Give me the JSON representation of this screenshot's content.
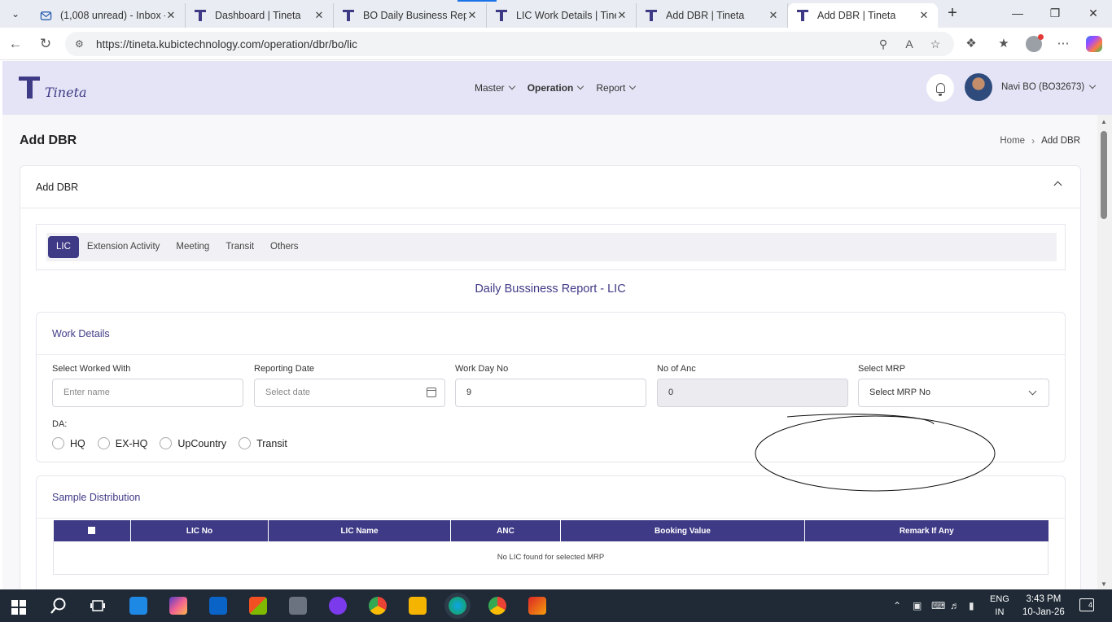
{
  "browser": {
    "tabs": [
      {
        "title": "(1,008 unread) - Inbox -",
        "icon": "mail-icon"
      },
      {
        "title": "Dashboard | Tineta",
        "icon": "tineta-favicon"
      },
      {
        "title": "BO Daily Business Repo",
        "icon": "tineta-favicon"
      },
      {
        "title": "LIC Work Details | Tinet",
        "icon": "tineta-favicon"
      },
      {
        "title": "Add DBR | Tineta",
        "icon": "tineta-favicon"
      },
      {
        "title": "Add DBR | Tineta",
        "icon": "tineta-favicon"
      }
    ],
    "url": "https://tineta.kubictechnology.com/operation/dbr/bo/lic"
  },
  "header": {
    "logo_text": "Tineta",
    "nav": [
      {
        "label": "Master"
      },
      {
        "label": "Operation"
      },
      {
        "label": "Report"
      }
    ],
    "user_name": "Navi BO (BO32673)"
  },
  "page": {
    "title": "Add DBR",
    "breadcrumb": {
      "home": "Home",
      "current": "Add DBR"
    }
  },
  "card": {
    "title": "Add DBR",
    "tabs": [
      "LIC",
      "Extension Activity",
      "Meeting",
      "Transit",
      "Others"
    ],
    "report_title": "Daily Bussiness Report - LIC"
  },
  "work_details": {
    "title": "Work Details",
    "fields": {
      "worked_with": {
        "label": "Select Worked With",
        "placeholder": "Enter name"
      },
      "reporting_date": {
        "label": "Reporting Date",
        "placeholder": "Select date"
      },
      "work_day_no": {
        "label": "Work Day No",
        "value": "9"
      },
      "no_of_anc": {
        "label": "No of Anc",
        "value": "0"
      },
      "mrp": {
        "label": "Select MRP",
        "value": "Select MRP No"
      }
    },
    "da": {
      "label": "DA:",
      "options": [
        "HQ",
        "EX-HQ",
        "UpCountry",
        "Transit"
      ]
    }
  },
  "sample_distribution": {
    "title": "Sample Distribution",
    "columns": [
      "LIC No",
      "LIC Name",
      "ANC",
      "Booking Value",
      "Remark If Any"
    ],
    "empty_text": "No LIC found for selected MRP"
  },
  "taskbar": {
    "lang_top": "ENG",
    "lang_bottom": "IN",
    "time": "3:43 PM",
    "date": "10-Jan-26",
    "notification_count": "4"
  },
  "colors": {
    "brand": "#3f3a86",
    "header_bg": "#e4e4f6",
    "taskbar_bg": "#1f2a36"
  }
}
